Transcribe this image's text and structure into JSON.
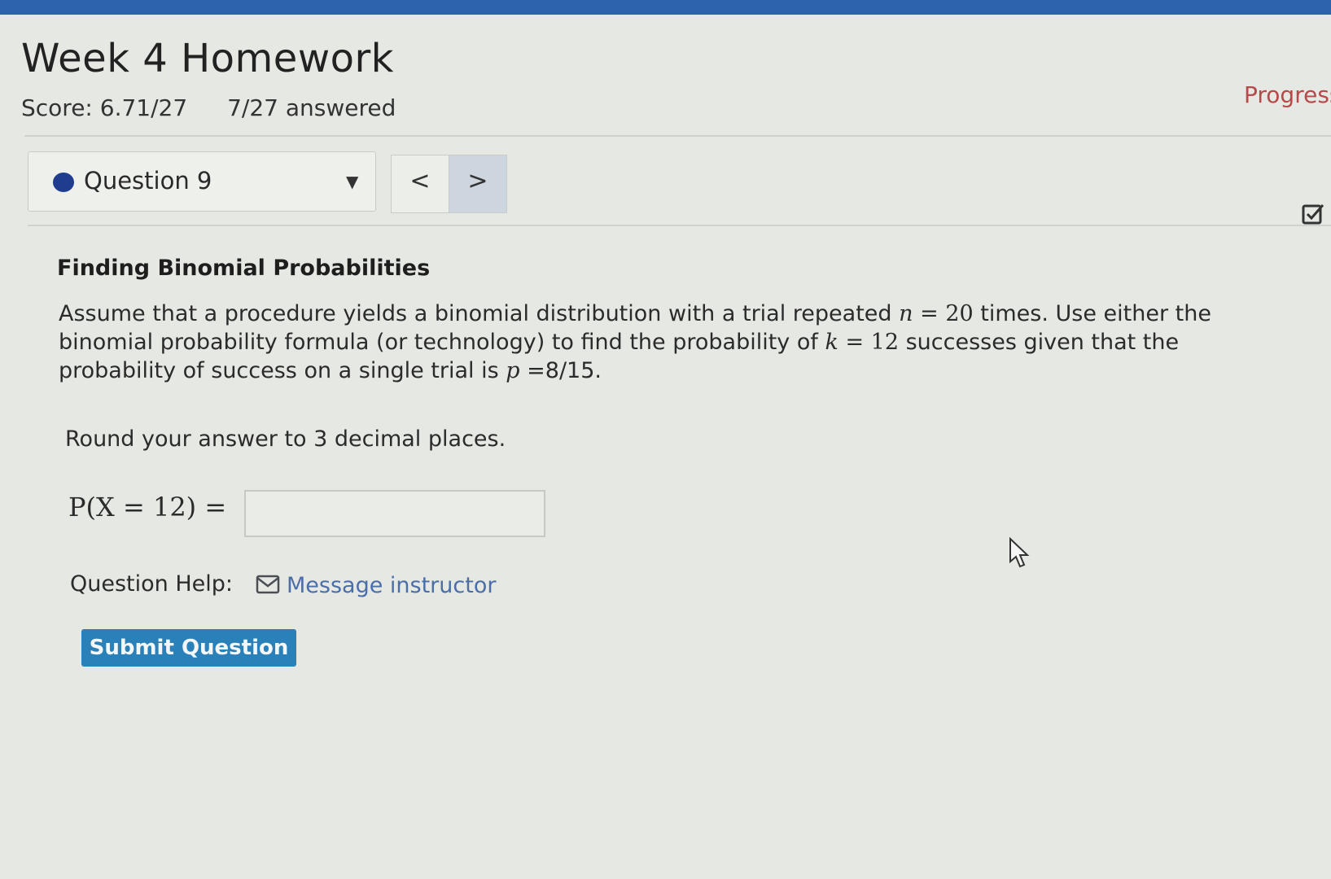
{
  "assignment": {
    "title": "Week 4 Homework",
    "score": "Score: 6.71/27",
    "answered": "7/27 answered",
    "progress_label": "Progress"
  },
  "question_nav": {
    "selected": "Question 9",
    "prev_symbol": "<",
    "next_symbol": ">",
    "status_color": "#1f3c8e"
  },
  "problem": {
    "title": "Finding Binomial Probabilities",
    "text_1": "Assume that a procedure yields a binomial distribution with a trial repeated ",
    "n_var": "n",
    "eq_1": " = ",
    "n_val": "20",
    "text_2": " times. Use either the binomial probability formula (or technology) to find the probability of ",
    "k_var": "k",
    "eq_2": " = ",
    "k_val": "12",
    "text_3": " successes given that the probability of success on a single trial is ",
    "p_var": "p",
    "p_val": " =8/15.",
    "round_instruction": "Round your answer to 3 decimal places.",
    "answer_label": "P(X = 12) =",
    "answer_value": ""
  },
  "help": {
    "label": "Question Help:",
    "message_link": "Message instructor"
  },
  "actions": {
    "submit_label": "Submit Question"
  },
  "colors": {
    "header_bar": "#2d63ad",
    "link": "#4b6ea8",
    "progress": "#b54a4a",
    "submit": "#2a80b8"
  }
}
